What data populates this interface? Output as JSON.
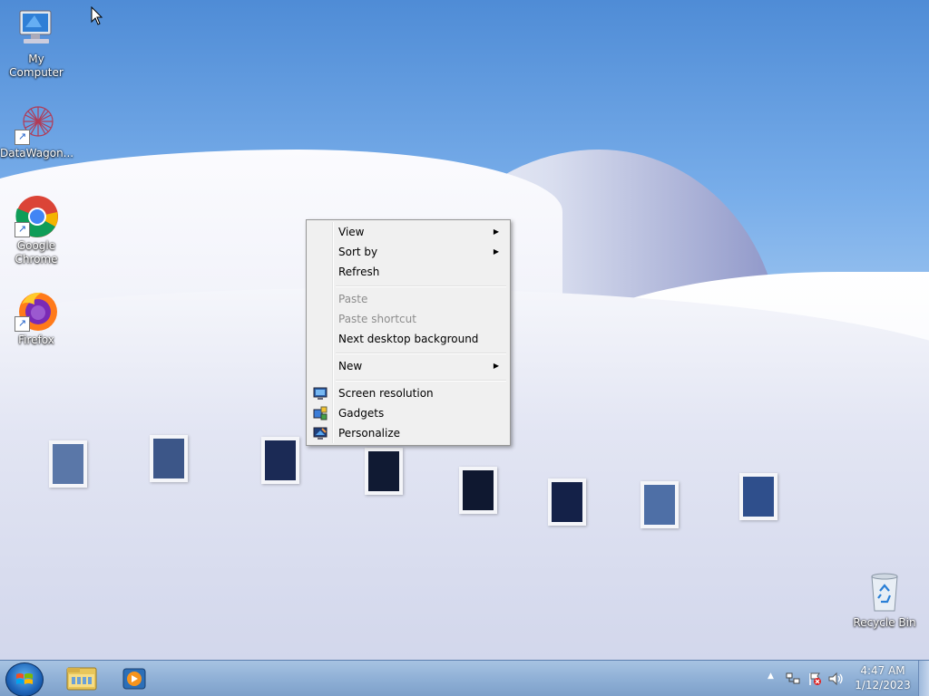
{
  "desktop": {
    "icons": [
      {
        "label": "My Computer",
        "icon": "computer-icon"
      },
      {
        "label": "DataWagon...",
        "icon": "datawagon-icon"
      },
      {
        "label": "Google Chrome",
        "icon": "chrome-icon"
      },
      {
        "label": "Firefox",
        "icon": "firefox-icon"
      },
      {
        "label": "Recycle Bin",
        "icon": "recycle-bin-icon"
      }
    ]
  },
  "context_menu": {
    "items": [
      {
        "label": "View",
        "submenu": true,
        "enabled": true
      },
      {
        "label": "Sort by",
        "submenu": true,
        "enabled": true
      },
      {
        "label": "Refresh",
        "enabled": true
      },
      {
        "label": "Paste",
        "enabled": false
      },
      {
        "label": "Paste shortcut",
        "enabled": false
      },
      {
        "label": "Next desktop background",
        "enabled": true
      },
      {
        "label": "New",
        "submenu": true,
        "enabled": true
      },
      {
        "label": "Screen resolution",
        "icon": "screen-resolution-icon",
        "enabled": true
      },
      {
        "label": "Gadgets",
        "icon": "gadgets-icon",
        "enabled": true
      },
      {
        "label": "Personalize",
        "icon": "personalize-icon",
        "enabled": true
      }
    ]
  },
  "taskbar": {
    "pinned": [
      {
        "name": "windows-explorer-button",
        "icon": "folder-icon"
      },
      {
        "name": "media-player-button",
        "icon": "media-player-icon"
      }
    ],
    "clock": {
      "time": "4:47 AM",
      "date": "1/12/2023"
    }
  }
}
